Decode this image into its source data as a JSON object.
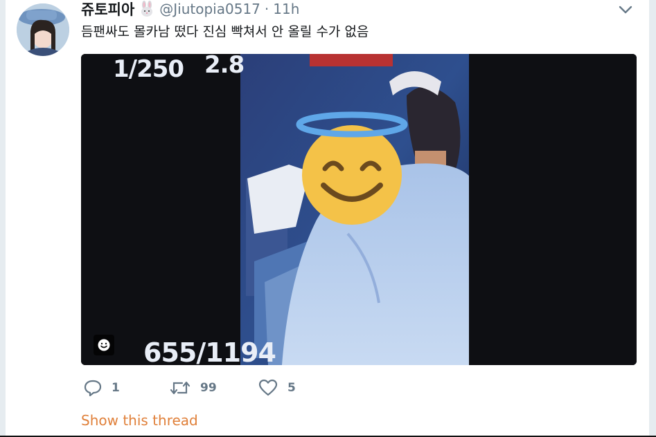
{
  "tweet": {
    "display_name": "쥬토피아",
    "handle": "@Jiutopia0517",
    "separator": "·",
    "time": "11h",
    "text": "듬팬싸도 몰카남 떴다 진심 빡쳐서 안 올릴 수가 없음"
  },
  "media": {
    "shutter": "1/250",
    "aperture": "2.8",
    "counter": "655/1194",
    "emoji": "smiling-face-with-halo"
  },
  "actions": {
    "replies": "1",
    "retweets": "99",
    "likes": "5"
  },
  "thread_link": "Show this thread",
  "colors": {
    "link_orange": "#e0803a",
    "muted": "#657786",
    "rail": "#e6ecf0"
  }
}
